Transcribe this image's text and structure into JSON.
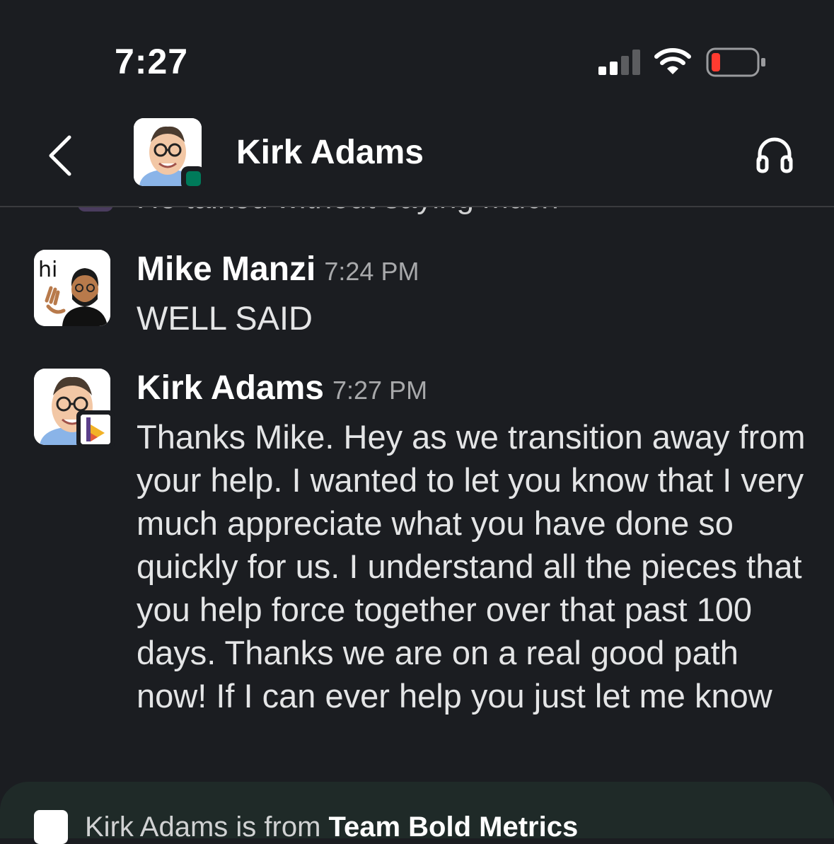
{
  "status_bar": {
    "time": "7:27"
  },
  "header": {
    "title": "Kirk Adams"
  },
  "cutoff_message": "He talked without saying much",
  "messages": [
    {
      "author": "Mike Manzi",
      "time": "7:24 PM",
      "text": "WELL SAID",
      "avatar_text": "hi"
    },
    {
      "author": "Kirk Adams",
      "time": "7:27 PM",
      "text": "Thanks Mike. Hey as we transition away from your help. I wanted to let you know that I very much appreciate what you have done so quickly for us. I understand all the pieces that you help force together over that past 100 days. Thanks we are on a real good path now!  If I can ever help you just let me know"
    }
  ],
  "bottom_banner": {
    "prefix": "Kirk Adams is from ",
    "team": "Team Bold Metrics"
  },
  "colors": {
    "background": "#1b1d21",
    "presence": "#007a5a",
    "battery_low": "#ff3b30"
  }
}
